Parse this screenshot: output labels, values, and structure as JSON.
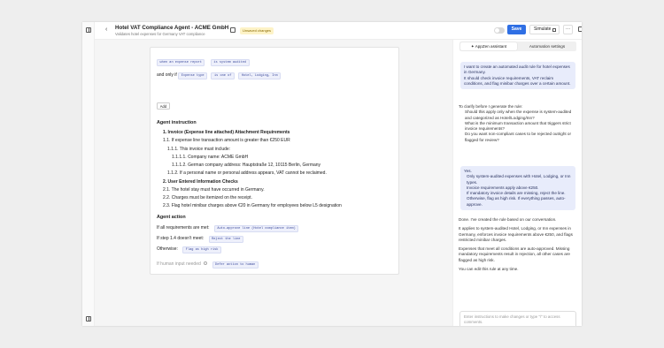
{
  "header": {
    "back_icon": "chevron-left-icon",
    "title": "Hotel VAT Compliance Agent - ACME GmbH",
    "subtitle": "Validates hotel expenses for Germany VAT compliance",
    "unsaved": "Unsaved changes",
    "save": "Save",
    "simulate": "Simulate",
    "more": "···"
  },
  "editor": {
    "cond_chip_a": "when an expense report",
    "cond_chip_b": "is system audited",
    "and_only_if": "and only if",
    "cond_chip_c": "Expense type",
    "cond_chip_d": "is one of",
    "cond_chip_e": "Hotel, Lodging, Inn",
    "add": "Add",
    "instruction_heading": "Agent instruction",
    "ins_1": "1. Invoice (Expense line attached) Attachment Requirements",
    "ins_1_1": "1.1. If expense line transaction amount is greater than €250 EUR",
    "ins_1_1_1": "1.1.1. This invoice must include:",
    "ins_1_1_1_1": "1.1.1.1. Company name: ACME GmbH",
    "ins_1_1_1_2": "1.1.1.2. German company address: Hauptstraße 12, 10115 Berlin, Germany",
    "ins_1_1_2": "1.1.2. If a personal name or personal address appears, VAT cannot be reclaimed.",
    "ins_2": "2. User Entered Information Checks",
    "ins_2_1": "2.1. The hotel stay must have occurred in Germany.",
    "ins_2_2": "2.2. Charges must be itemized on the receipt.",
    "ins_2_3": "2.3. Flag hotel minibar charges above €20 in Germany for employees below L5 designation",
    "action_heading": "Agent action",
    "act_1_label": "If all requirements are met:",
    "act_1_chip": "Auto-approve line (Hotel compliance item)",
    "act_2_label": "If step 1.4 doesn't meet:",
    "act_2_chip": "Reject the line",
    "act_3_label": "Otherwise:",
    "act_3_chip": "Flag as high risk",
    "hi_label": "If human input needed",
    "hi_chip": "Defer action to human"
  },
  "chat": {
    "tab_assistant": "AppZen assistant",
    "tab_settings": "Automation settings",
    "user_msg_1": "I want to create an automated audit rule for hotel expenses in Germany.",
    "user_msg_2": "It should check invoice requirements, VAT reclaim conditions, and flag minibar charges over a certain amount.",
    "ai_intro": "To clarify before I generate the rule:",
    "ai_q1": "Should this apply only when the expense is system-audited and categorized as Hotel/Lodging/Inn?",
    "ai_q2": "What is the minimum transaction amount that triggers strict invoice requirements?",
    "ai_q3": "Do you want non-compliant cases to be rejected outright or flagged for review?",
    "user_yes": "Yes.",
    "user_a1": "Only system-audited expenses with Hotel, Lodging, or Inn types.",
    "user_a2": "Invoice requirements apply above €250.",
    "user_a3": "If mandatory invoice details are missing, reject the line. Otherwise, flag as high risk. If everything passes, auto-approve.",
    "ai_done": "Done. I've created the rule based on our conversation.",
    "ai_summary_1": "It applies to system-audited Hotel, Lodging, or Inn expenses in Germany, enforces invoice requirements above €250, and flags restricted minibar charges.",
    "ai_summary_2": "Expenses that meet all conditions are auto-approved. Missing mandatory requirements result in rejection, all other cases are flagged as high risk.",
    "ai_edit": "You can edit this rule at any time.",
    "composer_placeholder": "Enter instructions to make changes or type \"/\" to access comments.",
    "send_icon": "arrow-up-icon",
    "sparkle_icon": "sparkle-icon"
  }
}
